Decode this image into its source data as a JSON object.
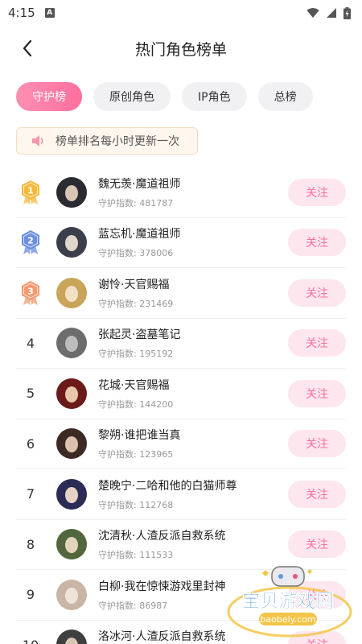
{
  "status_bar": {
    "time": "4:15",
    "a_badge": "A"
  },
  "header": {
    "title": "热门角色榜单"
  },
  "tabs": [
    {
      "label": "守护榜",
      "active": true
    },
    {
      "label": "原创角色",
      "active": false
    },
    {
      "label": "IP角色",
      "active": false
    },
    {
      "label": "总榜",
      "active": false
    }
  ],
  "notice": {
    "text": "榜单排名每小时更新一次"
  },
  "guard_prefix": "守护指数: ",
  "follow_label": "关注",
  "rankings": [
    {
      "rank": "1",
      "name": "魏无羡·魔道祖师",
      "guard_index": "481787"
    },
    {
      "rank": "2",
      "name": "蓝忘机·魔道祖师",
      "guard_index": "378006"
    },
    {
      "rank": "3",
      "name": "谢怜·天官赐福",
      "guard_index": "231469"
    },
    {
      "rank": "4",
      "name": "张起灵·盗墓笔记",
      "guard_index": "195192"
    },
    {
      "rank": "5",
      "name": "花城·天官赐福",
      "guard_index": "144200"
    },
    {
      "rank": "6",
      "name": "黎朔·谁把谁当真",
      "guard_index": "123965"
    },
    {
      "rank": "7",
      "name": "楚晚宁·二哈和他的白猫师尊",
      "guard_index": "112768"
    },
    {
      "rank": "8",
      "name": "沈清秋·人渣反派自救系统",
      "guard_index": "111533"
    },
    {
      "rank": "9",
      "name": "白柳·我在惊悚游戏里封神",
      "guard_index": "86987"
    },
    {
      "rank": "10",
      "name": "洛冰河·人渣反派自救系统",
      "guard_index": ""
    }
  ],
  "watermark": {
    "text": "宝贝游戏网",
    "url": "baobeiy.com"
  },
  "colors": {
    "accent": "#ff6f9e",
    "tab_active_start": "#ff8fb3",
    "follow_bg": "#fde6ee",
    "notice_bg": "#fff6ee",
    "gold": "#f4b83a",
    "silver": "#6c8fe0",
    "bronze": "#f39a6e"
  }
}
